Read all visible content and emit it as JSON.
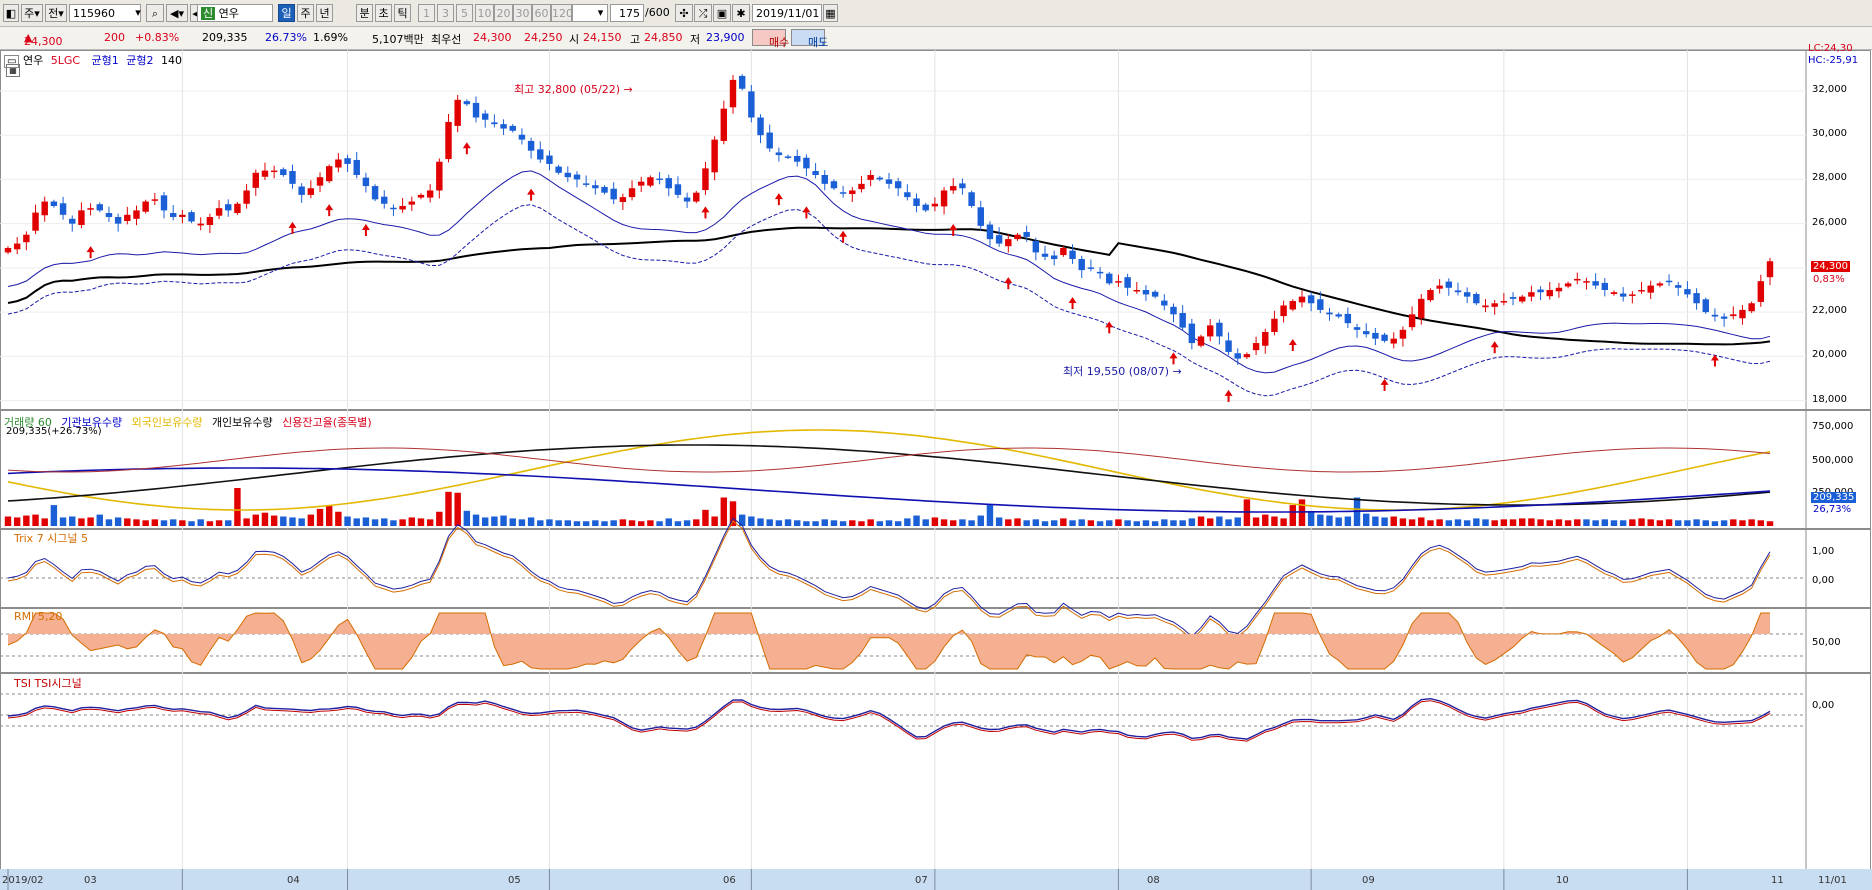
{
  "toolbar": {
    "type_label": "주",
    "jeon_label": "전",
    "code_value": "115960",
    "stock_badge": "신",
    "stock_name": "연우",
    "periods": [
      "일",
      "주",
      "년",
      "분",
      "초",
      "틱"
    ],
    "active_period": "일",
    "intervals": [
      "1",
      "3",
      "5",
      "10",
      "20",
      "30",
      "60",
      "120"
    ],
    "count_value": "175",
    "count_total": "/600",
    "date_value": "2019/11/01"
  },
  "quote": {
    "price": "24,300",
    "change": "200",
    "change_pct": "+0.83%",
    "volume": "209,335",
    "volume_pct": "26.73%",
    "turnover": "1.69%",
    "amount_label": "5,107백만",
    "preferred_label": "최우선",
    "ask": "24,300",
    "bid": "24,250",
    "open_label": "시",
    "open": "24,150",
    "high_label": "고",
    "high": "24,850",
    "low_label": "저",
    "low": "23,900",
    "buy_label": "매수",
    "sell_label": "매도"
  },
  "colors": {
    "up": "#e00000",
    "down": "#1a5fd6",
    "ma": "#000000",
    "env": "#1a1aa8"
  },
  "main_panel": {
    "legend": {
      "name": "연우",
      "ma": "5LGC",
      "bal1": "균형1",
      "bal2": "균형2",
      "num": "140"
    },
    "right_top": [
      "LC:24,30",
      "HC:-25,91"
    ],
    "price_ticks": [
      "32,000",
      "30,000",
      "28,000",
      "26,000",
      "24,000",
      "22,000",
      "20,000",
      "18,000"
    ],
    "current_price_tag": "24,300",
    "current_pct_tag": "0,83%",
    "high_note": "최고 32,800 (05/22)",
    "low_note": "최저 19,550 (08/07)"
  },
  "volume_panel": {
    "legend": [
      "거래량 60",
      "기관보유수량",
      "외국인보유수량",
      "개인보유수량",
      "신용잔고율(종목별)"
    ],
    "sub_label": "209,335(+26.73%)",
    "ticks": [
      "750,000",
      "500,000",
      "250,000"
    ],
    "tag_value": "209,335",
    "tag_pct": "26,73%"
  },
  "trix_panel": {
    "legend": "Trix 7  시그널 5",
    "ticks": [
      "1,00",
      "0,00"
    ]
  },
  "rmi_panel": {
    "legend": "RMI 5,20",
    "ticks": [
      "50,00"
    ]
  },
  "tsi_panel": {
    "legend": "TSI  TSI시그널",
    "ticks": [
      "0,00"
    ]
  },
  "x_axis": [
    "2019/02",
    "03",
    "04",
    "05",
    "06",
    "07",
    "08",
    "09",
    "10",
    "11",
    "11/01"
  ],
  "chart_data": {
    "type": "candlestick",
    "ylim": [
      17800,
      33400
    ],
    "month_starts": [
      0,
      19,
      37,
      59,
      81,
      101,
      121,
      142,
      163,
      183
    ],
    "prices": [
      24900,
      25100,
      25500,
      26500,
      27000,
      26800,
      26400,
      26000,
      26600,
      26700,
      26600,
      26300,
      26000,
      26400,
      26600,
      27000,
      27100,
      26600,
      26300,
      26400,
      26100,
      26000,
      26300,
      26700,
      26600,
      26900,
      27500,
      28300,
      28400,
      28400,
      28200,
      27800,
      27300,
      27600,
      28100,
      28600,
      28900,
      28700,
      28200,
      27700,
      27100,
      26900,
      26700,
      26800,
      27000,
      27300,
      27500,
      28800,
      30600,
      31600,
      31400,
      30800,
      30700,
      30500,
      30300,
      30200,
      29800,
      29300,
      28900,
      28700,
      28300,
      28100,
      28000,
      27800,
      27600,
      27400,
      27100,
      27200,
      27600,
      27900,
      28100,
      28000,
      27600,
      27300,
      27000,
      27400,
      28500,
      29800,
      31200,
      32500,
      32100,
      30800,
      30000,
      29400,
      29100,
      29000,
      28800,
      28500,
      28200,
      27800,
      27600,
      27400,
      27500,
      27800,
      28200,
      28000,
      27800,
      27600,
      27200,
      26800,
      26600,
      26900,
      27500,
      27700,
      27600,
      26800,
      25900,
      25300,
      25100,
      25300,
      25500,
      25400,
      24700,
      24500,
      24400,
      24900,
      24400,
      23900,
      24000,
      23800,
      23300,
      23400,
      23100,
      23000,
      22800,
      22700,
      22300,
      21900,
      21300,
      20600,
      20900,
      21400,
      20900,
      20200,
      19900,
      20100,
      20600,
      21100,
      21700,
      22300,
      22500,
      22700,
      22400,
      22100,
      21900,
      21800,
      21500,
      21200,
      21000,
      20800,
      20700,
      20800,
      21200,
      21900,
      22600,
      23000,
      23200,
      23100,
      22900,
      22700,
      22400,
      22300,
      22400,
      22500,
      22600,
      22700,
      22900,
      22900,
      23000,
      23100,
      23300,
      23500,
      23400,
      23200,
      23000,
      22900,
      22700,
      22800,
      23000,
      23200,
      23300,
      23400,
      23100,
      22800,
      22400,
      22000,
      21800,
      21700,
      21900,
      22100,
      22400,
      23400,
      24300
    ],
    "volume": [
      0.1,
      0.09,
      0.11,
      0.12,
      0.08,
      0.22,
      0.09,
      0.1,
      0.08,
      0.09,
      0.12,
      0.07,
      0.09,
      0.08,
      0.07,
      0.06,
      0.07,
      0.06,
      0.07,
      0.06,
      0.05,
      0.07,
      0.05,
      0.06,
      0.06,
      0.4,
      0.08,
      0.12,
      0.14,
      0.11,
      0.1,
      0.09,
      0.08,
      0.12,
      0.18,
      0.21,
      0.15,
      0.1,
      0.08,
      0.09,
      0.07,
      0.08,
      0.06,
      0.07,
      0.09,
      0.08,
      0.07,
      0.15,
      0.36,
      0.35,
      0.16,
      0.12,
      0.09,
      0.1,
      0.11,
      0.08,
      0.07,
      0.09,
      0.06,
      0.07,
      0.06,
      0.06,
      0.05,
      0.05,
      0.06,
      0.05,
      0.06,
      0.07,
      0.06,
      0.05,
      0.06,
      0.05,
      0.08,
      0.05,
      0.06,
      0.07,
      0.17,
      0.1,
      0.3,
      0.26,
      0.12,
      0.1,
      0.08,
      0.07,
      0.06,
      0.07,
      0.06,
      0.05,
      0.05,
      0.07,
      0.06,
      0.05,
      0.06,
      0.05,
      0.07,
      0.05,
      0.06,
      0.05,
      0.08,
      0.11,
      0.07,
      0.09,
      0.07,
      0.06,
      0.07,
      0.06,
      0.11,
      0.22,
      0.09,
      0.07,
      0.08,
      0.06,
      0.07,
      0.05,
      0.06,
      0.08,
      0.06,
      0.07,
      0.06,
      0.05,
      0.06,
      0.07,
      0.06,
      0.05,
      0.06,
      0.05,
      0.07,
      0.06,
      0.06,
      0.08,
      0.1,
      0.08,
      0.1,
      0.07,
      0.09,
      0.28,
      0.09,
      0.12,
      0.1,
      0.08,
      0.22,
      0.28,
      0.15,
      0.12,
      0.11,
      0.09,
      0.1,
      0.3,
      0.13,
      0.1,
      0.09,
      0.1,
      0.08,
      0.07,
      0.09,
      0.06,
      0.07,
      0.06,
      0.07,
      0.06,
      0.08,
      0.07,
      0.06,
      0.07,
      0.07,
      0.08,
      0.08,
      0.07,
      0.06,
      0.07,
      0.06,
      0.07,
      0.07,
      0.06,
      0.07,
      0.06,
      0.06,
      0.07,
      0.08,
      0.07,
      0.06,
      0.07,
      0.06,
      0.06,
      0.07,
      0.06,
      0.05,
      0.06,
      0.07,
      0.06,
      0.07,
      0.06,
      0.05,
      0.05,
      0.06,
      0.07,
      0.06,
      0.05,
      0.06,
      0.06,
      0.08,
      0.06,
      0.18,
      0.94,
      0.27
    ],
    "buy_signal_indices": [
      9,
      31,
      35,
      39,
      50,
      57,
      76,
      84,
      87,
      91,
      103,
      109,
      116,
      120,
      127,
      133,
      140,
      150,
      162,
      186,
      199,
      209,
      216,
      227
    ],
    "last": {
      "open": 24150,
      "high": 24850,
      "low": 23900,
      "close": 24300,
      "volume": 209335
    }
  }
}
